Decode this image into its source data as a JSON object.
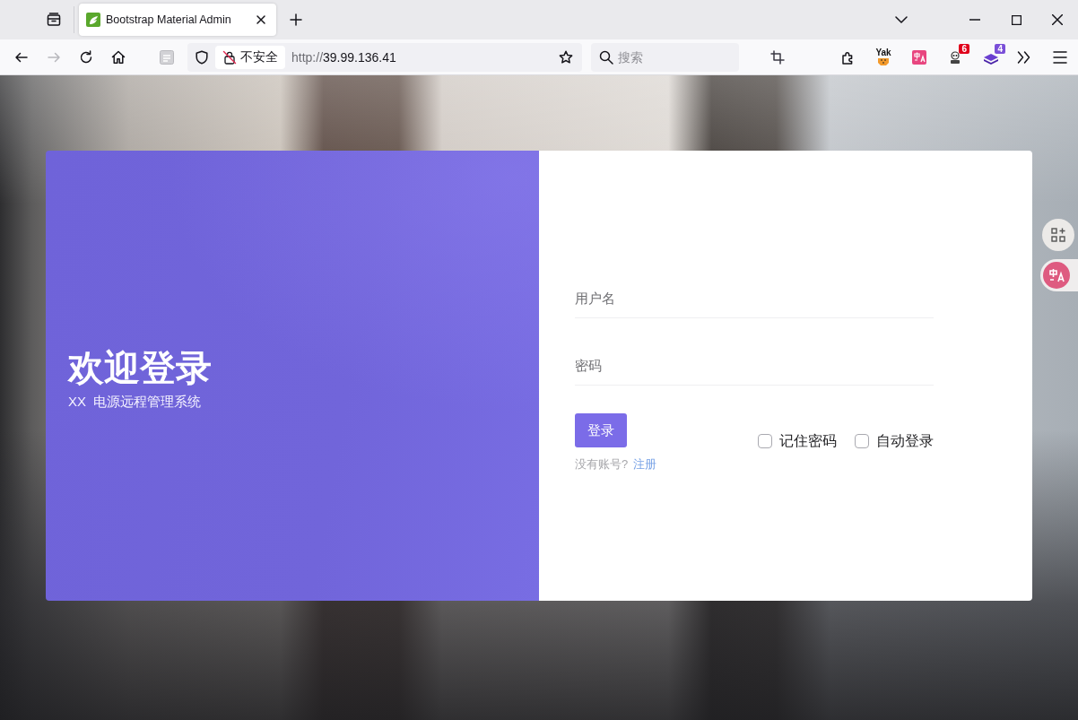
{
  "browser": {
    "tabs": [
      {
        "title": "Bootstrap Material Admin",
        "selected": true
      }
    ],
    "nav_buttons": [
      {
        "kind": "back",
        "disabled": false
      },
      {
        "kind": "forward",
        "disabled": true
      },
      {
        "kind": "reload",
        "disabled": false
      },
      {
        "kind": "home",
        "disabled": false
      }
    ],
    "address": {
      "security_label": "不安全",
      "url_scheme": "http://",
      "url_host": "39.99.136.41"
    },
    "search": {
      "placeholder": "搜索"
    },
    "extensions": [
      {
        "kind": "yak",
        "label": "Yak"
      },
      {
        "kind": "translate"
      },
      {
        "kind": "figure",
        "badge": "6"
      },
      {
        "kind": "layers",
        "badge": "4"
      }
    ]
  },
  "login": {
    "title": "欢迎登录",
    "subtitle": "XX  电源远程管理系统",
    "fields": [
      {
        "placeholder": "用户名"
      },
      {
        "placeholder": "密码"
      }
    ],
    "submit": "登录",
    "options": [
      {
        "label": "记住密码",
        "checked": false
      },
      {
        "label": "自动登录",
        "checked": false
      }
    ],
    "signup_prompt": "没有账号?",
    "signup_link": "注册"
  },
  "side_buttons": [
    {
      "kind": "apps"
    },
    {
      "kind": "translate"
    }
  ]
}
